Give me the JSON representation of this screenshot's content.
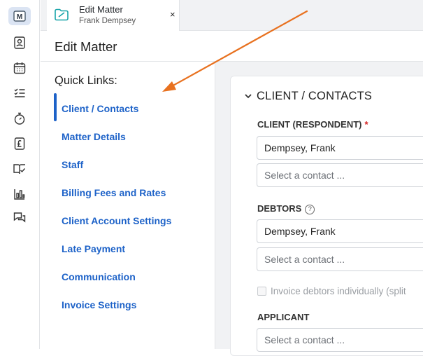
{
  "rail": {
    "items": [
      {
        "icon": "matter-logo-icon",
        "active": true
      },
      {
        "icon": "contact-card-icon"
      },
      {
        "icon": "calendar-icon"
      },
      {
        "icon": "task-list-icon"
      },
      {
        "icon": "stopwatch-icon"
      },
      {
        "icon": "pound-document-icon"
      },
      {
        "icon": "book-check-icon"
      },
      {
        "icon": "bar-chart-icon"
      },
      {
        "icon": "chat-bubbles-icon"
      }
    ],
    "logo_letter": "M"
  },
  "tab": {
    "title": "Edit Matter",
    "subtitle": "Frank Dempsey",
    "close": "×"
  },
  "page": {
    "title": "Edit Matter"
  },
  "quick_links": {
    "title": "Quick Links:",
    "items": [
      {
        "label": "Client / Contacts",
        "active": true
      },
      {
        "label": "Matter Details"
      },
      {
        "label": "Staff"
      },
      {
        "label": "Billing Fees and Rates"
      },
      {
        "label": "Client Account Settings"
      },
      {
        "label": "Late Payment"
      },
      {
        "label": "Communication"
      },
      {
        "label": "Invoice Settings"
      }
    ]
  },
  "section": {
    "title": "CLIENT / CONTACTS",
    "client_label": "CLIENT (RESPONDENT)",
    "required_mark": "*",
    "client_value": "Dempsey, Frank",
    "client_placeholder": "Select a contact ...",
    "debtors_label": "DEBTORS",
    "help_mark": "?",
    "debtors_value": "Dempsey, Frank",
    "debtors_placeholder": "Select a contact ...",
    "invoice_individually_label": "Invoice debtors individually (split",
    "applicant_label": "APPLICANT",
    "applicant_placeholder": "Select a contact ..."
  },
  "colors": {
    "accent": "#1d62c8",
    "annotation_arrow": "#e8711f",
    "required": "#d42020"
  }
}
